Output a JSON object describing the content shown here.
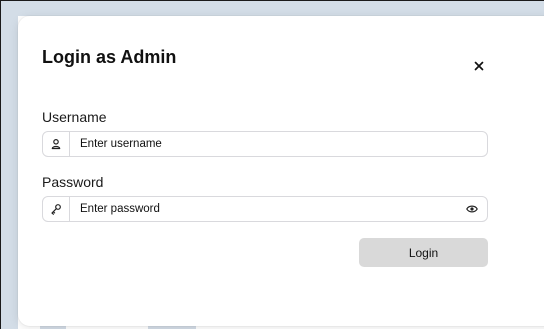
{
  "modal": {
    "title": "Login as Admin",
    "close_icon": "close-icon"
  },
  "username": {
    "label": "Username",
    "placeholder": "Enter username",
    "icon": "user-icon"
  },
  "password": {
    "label": "Password",
    "placeholder": "Enter password",
    "icon": "key-icon",
    "toggle_icon": "eye-icon"
  },
  "login_button": "Login",
  "colors": {
    "background_block": "#d3dde7",
    "button": "#d9d9d9",
    "border": "#d9d9dd"
  }
}
